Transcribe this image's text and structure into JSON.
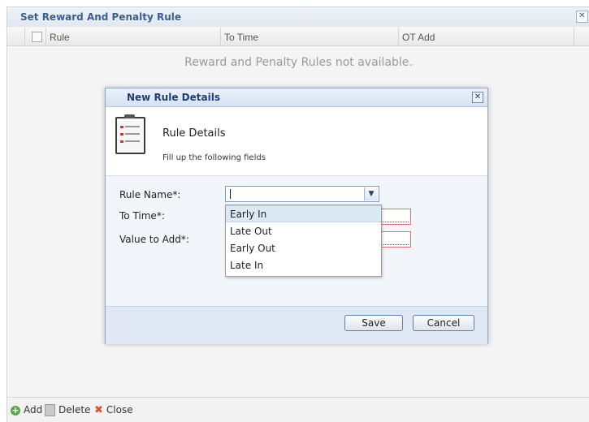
{
  "outer": {
    "title": "Set Reward And Penalty Rule",
    "close_glyph": "✕",
    "columns": [
      "Rule",
      "To Time",
      "OT Add"
    ],
    "empty_message": "Reward and Penalty Rules not available.",
    "bottom": {
      "add_label": "Add",
      "delete_label": "Delete",
      "close_label": "Close",
      "add_glyph": "+",
      "close_glyph": "✖"
    }
  },
  "modal": {
    "title": "New Rule Details",
    "close_glyph": "✕",
    "heading": "Rule Details",
    "subheading": "Fill up the following fields",
    "fields": {
      "rule_name_label": "Rule Name*:",
      "to_time_label": "To Time*:",
      "value_label": "Value to Add*:"
    },
    "dropdown_arrow": "▼",
    "options": [
      "Early In",
      "Late Out",
      "Early Out",
      "Late In"
    ],
    "save_label": "Save",
    "cancel_label": "Cancel"
  },
  "icons": {
    "add": "add-circle-icon",
    "delete": "trash-icon",
    "close": "close-x-icon",
    "clipboard": "clipboard-checklist-icon"
  },
  "colors": {
    "title_text": "#3b5f8f",
    "modal_title_text": "#1f3f73",
    "invalid_border": "#e07070"
  }
}
